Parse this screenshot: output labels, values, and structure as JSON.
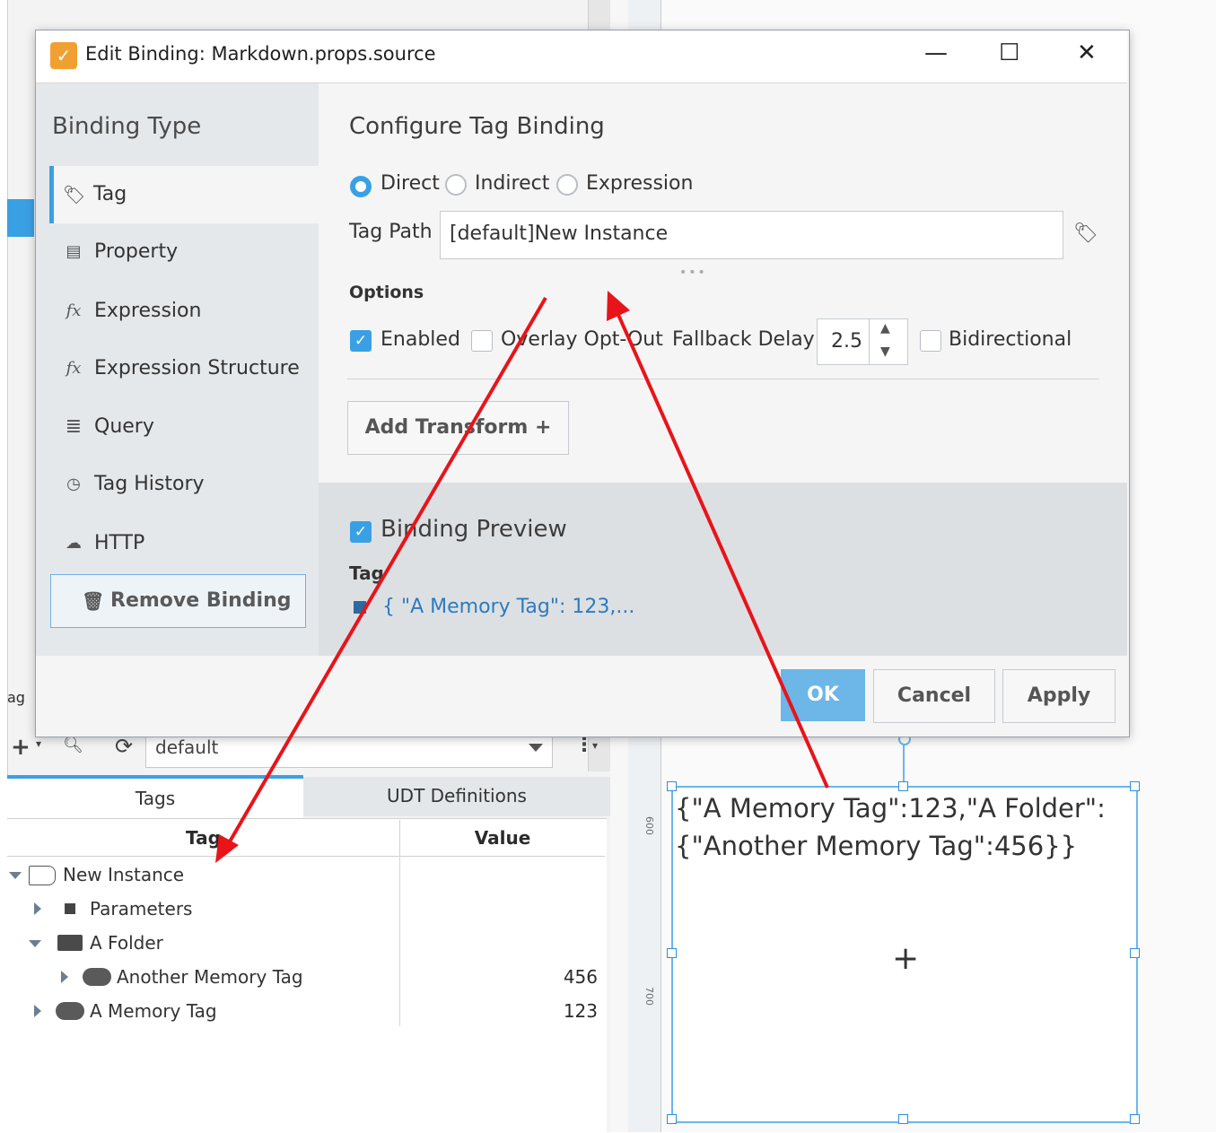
{
  "dialog": {
    "title": "Edit Binding: Markdown.props.source",
    "minimize": "—",
    "maximize": "☐",
    "close": "✕"
  },
  "sidebar": {
    "title": "Binding Type",
    "items": [
      {
        "label": "Tag",
        "icon": "tag-icon"
      },
      {
        "label": "Property",
        "icon": "property-icon"
      },
      {
        "label": "Expression",
        "icon": "fx-icon"
      },
      {
        "label": "Expression Structure",
        "icon": "fx-icon"
      },
      {
        "label": "Query",
        "icon": "database-icon"
      },
      {
        "label": "Tag History",
        "icon": "clock-icon"
      },
      {
        "label": "HTTP",
        "icon": "cloud-icon"
      }
    ],
    "remove_label": "Remove Binding"
  },
  "config": {
    "title": "Configure Tag Binding",
    "modes": [
      "Direct",
      "Indirect",
      "Expression"
    ],
    "selected_mode": "Direct",
    "tag_path_label": "Tag Path",
    "tag_path_value": "[default]New Instance",
    "options_label": "Options",
    "enabled_label": "Enabled",
    "overlay_label": "Overlay Opt-Out",
    "fallback_label": "Fallback Delay",
    "fallback_value": "2.5",
    "bidirectional_label": "Bidirectional",
    "add_transform_label": "Add Transform +"
  },
  "preview": {
    "title": "Binding Preview",
    "tag_label": "Tag",
    "value": "{   \"A Memory Tag\": 123,..."
  },
  "buttons": {
    "ok": "OK",
    "cancel": "Cancel",
    "apply": "Apply"
  },
  "tag_browser": {
    "tab_fragment": "ag",
    "provider": "default",
    "tabs": [
      "Tags",
      "UDT Definitions"
    ],
    "columns": [
      "Tag",
      "Value"
    ],
    "rows": [
      {
        "name": "New Instance",
        "value": ""
      },
      {
        "name": "Parameters",
        "value": ""
      },
      {
        "name": "A Folder",
        "value": ""
      },
      {
        "name": "Another Memory Tag",
        "value": "456"
      },
      {
        "name": "A Memory Tag",
        "value": "123"
      }
    ]
  },
  "canvas": {
    "component_text": "{\"A Memory Tag\":123,\"A Folder\":{\"Another Memory Tag\":456}}",
    "component_line1": "{\"A Memory Tag\":123,\"A Folder\":",
    "component_line2": "{\"Another Memory Tag\":456}}",
    "ruler_labels": [
      "600",
      "700"
    ]
  },
  "colors": {
    "accent": "#3aa0e4",
    "annotation_arrow": "#e8141a",
    "ok_button": "#6cb6e8"
  }
}
